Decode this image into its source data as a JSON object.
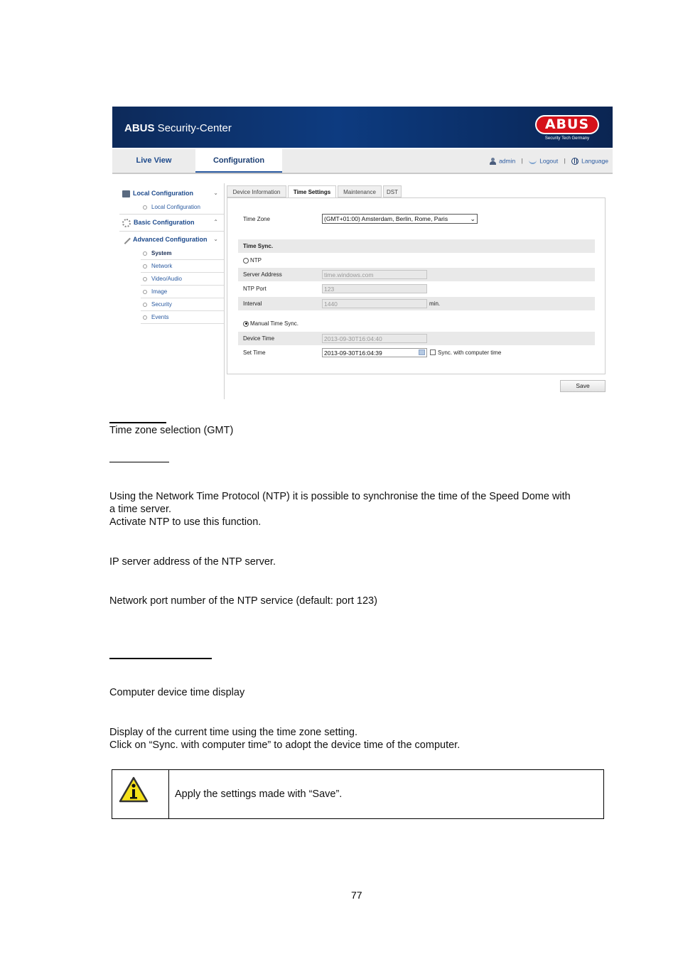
{
  "app": {
    "brand_bold": "ABUS",
    "brand_rest": " Security-Center",
    "logo_text": "ABUS",
    "logo_tagline": "Security Tech Germany"
  },
  "nav": {
    "tabs": [
      {
        "label": "Live View",
        "active": false
      },
      {
        "label": "Configuration",
        "active": true
      }
    ],
    "user": "admin",
    "logout": "Logout",
    "language": "Language",
    "separator": "|"
  },
  "sidebar": {
    "groups": [
      {
        "label": "Local Configuration",
        "chevron": "⌄",
        "icon": "monitor-icon"
      },
      {
        "label": "Basic Configuration",
        "chevron": "⌃",
        "icon": "gear-icon"
      },
      {
        "label": "Advanced Configuration",
        "chevron": "⌄",
        "icon": "wrench-icon"
      }
    ],
    "local_items": [
      "Local Configuration"
    ],
    "advanced_items": [
      {
        "label": "System",
        "selected": true
      },
      {
        "label": "Network",
        "selected": false
      },
      {
        "label": "Video/Audio",
        "selected": false
      },
      {
        "label": "Image",
        "selected": false
      },
      {
        "label": "Security",
        "selected": false
      },
      {
        "label": "Events",
        "selected": false
      }
    ]
  },
  "content": {
    "tabs": [
      {
        "label": "Device Information",
        "active": false
      },
      {
        "label": "Time Settings",
        "active": true
      },
      {
        "label": "Maintenance",
        "active": false
      },
      {
        "label": "DST",
        "active": false
      }
    ],
    "time_zone_label": "Time Zone",
    "time_zone_value": "(GMT+01:00) Amsterdam, Berlin, Rome, Paris",
    "time_sync_header": "Time Sync.",
    "ntp_label": "NTP",
    "ntp_selected": false,
    "server_address_label": "Server Address",
    "server_address_value": "time.windows.com",
    "ntp_port_label": "NTP Port",
    "ntp_port_value": "123",
    "interval_label": "Interval",
    "interval_value": "1440",
    "interval_unit": "min.",
    "manual_label": "Manual Time Sync.",
    "manual_selected": true,
    "device_time_label": "Device Time",
    "device_time_value": "2013-09-30T16:04:40",
    "set_time_label": "Set Time",
    "set_time_value": "2013-09-30T16:04:39",
    "sync_computer_label": "Sync. with computer time",
    "sync_computer_checked": false,
    "save_label": "Save"
  },
  "document": {
    "time_zone_desc": "Time zone selection (GMT)",
    "ntp_desc_1": "Using the Network Time Protocol (NTP) it is possible to synchronise the time of the Speed Dome with",
    "ntp_desc_2": "a time server.",
    "ntp_desc_3": "Activate NTP to use this function.",
    "server_desc": "IP server address of the NTP server.",
    "port_desc": "Network port number of the NTP service (default: port 123)",
    "device_time_desc": "Computer device time display",
    "set_time_desc_1": "Display of the current time using the time zone setting.",
    "set_time_desc_2": "Click on “Sync. with computer time” to adopt the device time of the computer.",
    "note": "Apply the settings made with “Save”.",
    "page_number": "77"
  }
}
